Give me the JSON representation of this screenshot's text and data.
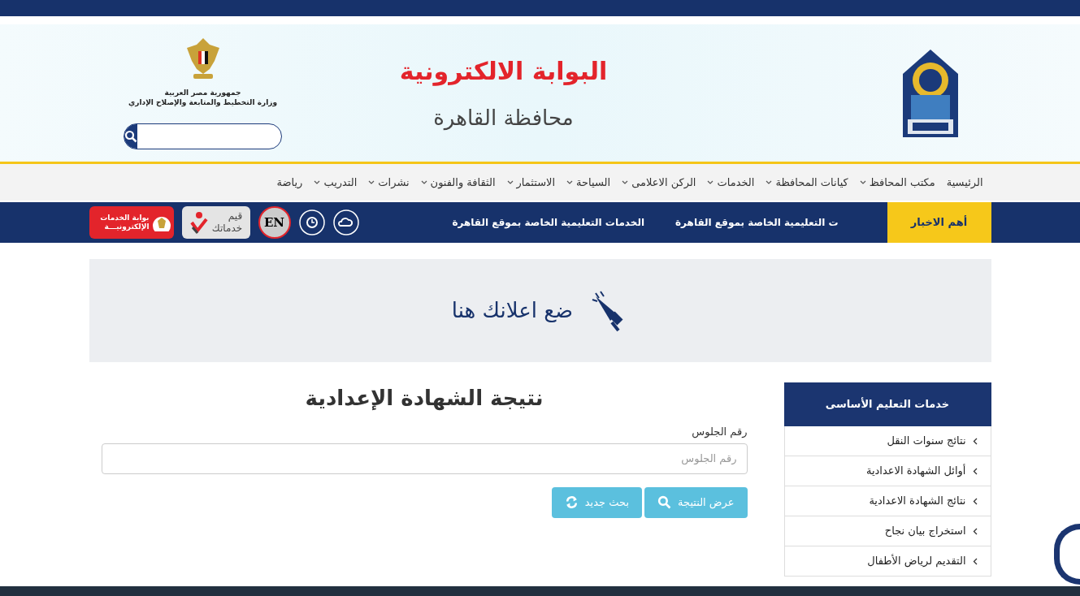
{
  "header": {
    "title": "البوابة الالكترونية",
    "subtitle": "محافظة القاهرة",
    "emblem_lines": [
      "جمهورية مصر العربية",
      "وزارة التخطيط والمتابعة والإصلاح الإداري"
    ]
  },
  "nav": [
    {
      "label": "الرئيسية",
      "dropdown": false
    },
    {
      "label": "مكتب المحافظ",
      "dropdown": true
    },
    {
      "label": "كيانات المحافظة",
      "dropdown": true
    },
    {
      "label": "الخدمات",
      "dropdown": true
    },
    {
      "label": "الركن الاعلامى",
      "dropdown": true
    },
    {
      "label": "السياحة",
      "dropdown": true
    },
    {
      "label": "الاستثمار",
      "dropdown": true
    },
    {
      "label": "الثقافة والفنون",
      "dropdown": true
    },
    {
      "label": "نشرات",
      "dropdown": true
    },
    {
      "label": "التدريب",
      "dropdown": true
    },
    {
      "label": "رياضة",
      "dropdown": false
    }
  ],
  "news": {
    "label": "أهم الاخبار",
    "ticker": [
      "ت التعليمية الخاصة بموقع القاهرة",
      "الخدمات التعليمية الخاصة بموقع القاهرة"
    ]
  },
  "language_badge": "EN",
  "rate_badge": [
    "قيم",
    "خدماتك"
  ],
  "eservices_badge": [
    "بوابة الخدمات",
    "الإلكترونيـــة"
  ],
  "ad": {
    "text": "ضع اعلانك هنا"
  },
  "form": {
    "title": "نتيجة الشهادة الإعدادية",
    "field_label": "رقم الجلوس",
    "placeholder": "رقم الجلوس",
    "buttons": [
      {
        "label": "عرض النتيجة",
        "kind": "search"
      },
      {
        "label": "بحث جديد",
        "kind": "refresh"
      }
    ]
  },
  "sidebar": {
    "title": "خدمات التعليم الأساسى",
    "items": [
      "نتائج سنوات النقل",
      "أوائل الشهادة الاعدادية",
      "نتائج الشهادة الاعدادية",
      "استخراج بيان نجاح",
      "التقديم لرياض الأطفال"
    ]
  }
}
